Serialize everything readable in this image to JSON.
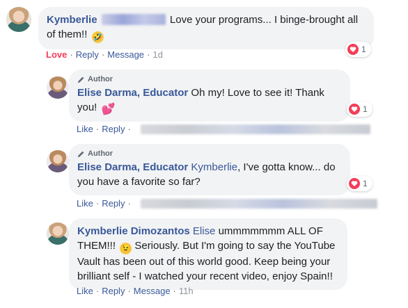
{
  "comments": [
    {
      "author": "Kymberlie",
      "text_before": "Love your programs... I binge-brought all of them!!",
      "emoji": "rolling-on-floor-laughing-icon",
      "emoji_char": "🤣",
      "actions": [
        "Love",
        "Reply",
        "Message"
      ],
      "time": "1d",
      "reaction_count": "1"
    },
    {
      "badge": "Author",
      "author": "Elise Darma, Educator",
      "text": "Oh my! Love to see it! Thank you!",
      "emoji": "two-hearts-icon",
      "emoji_char": "💕",
      "actions": [
        "Like",
        "Reply"
      ],
      "reaction_count": "1"
    },
    {
      "badge": "Author",
      "author": "Elise Darma, Educator",
      "mention": "Kymberlie",
      "text": ", I've gotta know... do you have a favorite so far?",
      "actions": [
        "Like",
        "Reply"
      ],
      "reaction_count": "1"
    },
    {
      "author": "Kymberlie Dimozantos",
      "mention": "Elise",
      "text_before": "ummmmmmm ALL OF THEM!!!",
      "emoji": "winking-face-icon",
      "emoji_char": "😉",
      "text_after": "Seriously. But I'm going to say the YouTube Vault has been out of this world good. Keep being your brilliant self - I watched your recent video, enjoy Spain!!",
      "actions": [
        "Like",
        "Reply",
        "Message"
      ],
      "time": "11h"
    }
  ],
  "colors": {
    "name": "#385898",
    "bubble": "#f2f3f5",
    "love": "#f33e58",
    "meta": "#606770"
  }
}
